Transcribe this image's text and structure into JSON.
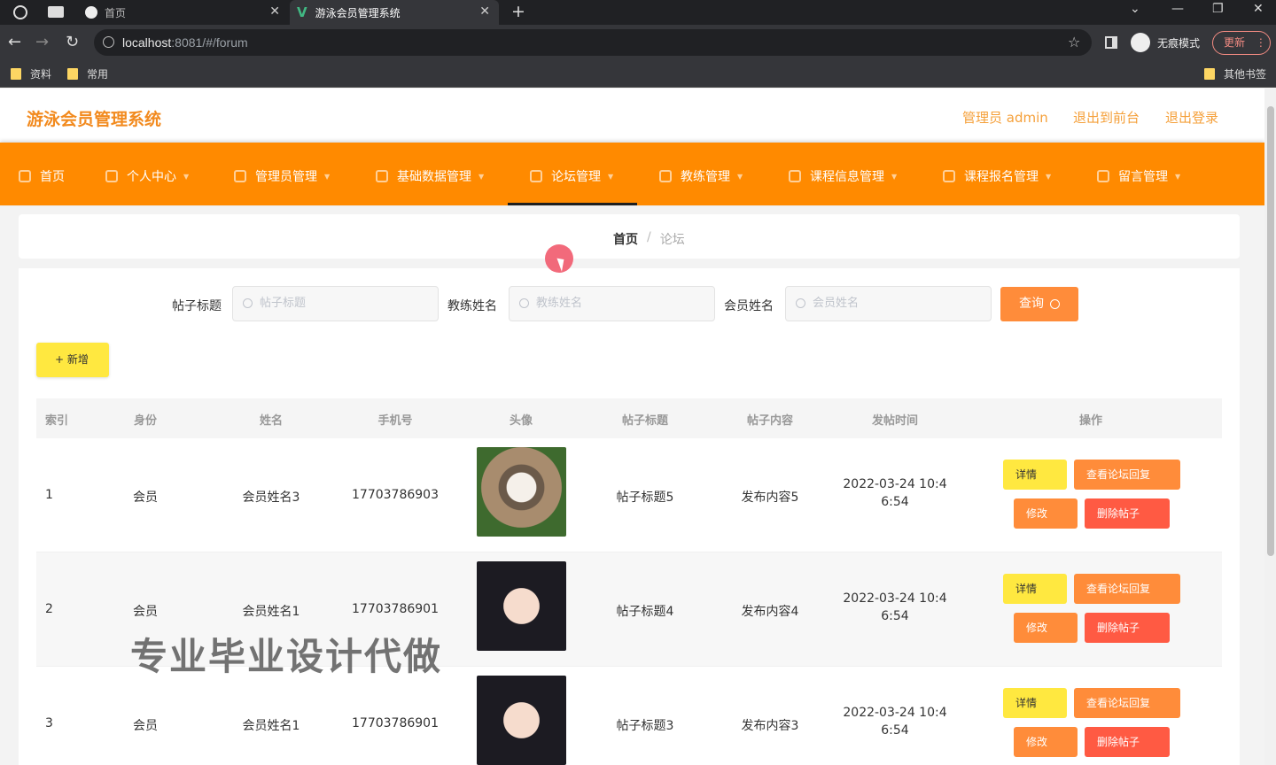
{
  "browser": {
    "tabs": [
      {
        "title": "首页"
      },
      {
        "title": "游泳会员管理系统"
      }
    ],
    "url_host": "localhost",
    "url_path": ":8081/#/forum",
    "incognito_label": "无痕模式",
    "update_label": "更新",
    "bookmarks": [
      "资料",
      "常用"
    ],
    "other_bookmarks": "其他书签"
  },
  "header": {
    "title": "游泳会员管理系统",
    "admin_label": "管理员 admin",
    "to_front_label": "退出到前台",
    "logout_label": "退出登录"
  },
  "menu": [
    {
      "label": "首页",
      "icon": "home-icon"
    },
    {
      "label": "个人中心",
      "icon": "user-icon"
    },
    {
      "label": "管理员管理",
      "icon": "admin-icon"
    },
    {
      "label": "基础数据管理",
      "icon": "list-icon"
    },
    {
      "label": "论坛管理",
      "icon": "forum-icon",
      "active": true
    },
    {
      "label": "教练管理",
      "icon": "coach-icon"
    },
    {
      "label": "课程信息管理",
      "icon": "course-icon"
    },
    {
      "label": "课程报名管理",
      "icon": "signup-icon"
    },
    {
      "label": "留言管理",
      "icon": "message-icon"
    }
  ],
  "breadcrumb": {
    "home": "首页",
    "separator": "/",
    "current": "论坛"
  },
  "filters": {
    "post_title_label": "帖子标题",
    "post_title_placeholder": "帖子标题",
    "coach_name_label": "教练姓名",
    "coach_name_placeholder": "教练姓名",
    "member_name_label": "会员姓名",
    "member_name_placeholder": "会员姓名",
    "search_label": "查询"
  },
  "add_label": "+ 新增",
  "table": {
    "columns": [
      "索引",
      "身份",
      "姓名",
      "手机号",
      "头像",
      "帖子标题",
      "帖子内容",
      "发帖时间",
      "操作"
    ],
    "rows": [
      {
        "index": "1",
        "role": "会员",
        "name": "会员姓名3",
        "phone": "17703786903",
        "avatar": "cat-photo",
        "title": "帖子标题5",
        "content": "发布内容5",
        "time1": "2022-03-24 10:4",
        "time2": "6:54"
      },
      {
        "index": "2",
        "role": "会员",
        "name": "会员姓名1",
        "phone": "17703786901",
        "avatar": "girl-photo",
        "title": "帖子标题4",
        "content": "发布内容4",
        "time1": "2022-03-24 10:4",
        "time2": "6:54"
      },
      {
        "index": "3",
        "role": "会员",
        "name": "会员姓名1",
        "phone": "17703786901",
        "avatar": "girl-photo",
        "title": "帖子标题3",
        "content": "发布内容3",
        "time1": "2022-03-24 10:4",
        "time2": "6:54"
      }
    ],
    "actions": {
      "detail": "详情",
      "reply": "查看论坛回复",
      "edit": "修改",
      "delete": "删除帖子"
    }
  },
  "watermark": "专业毕业设计代做",
  "colors": {
    "accent": "#ff8a00",
    "title": "#f28a1e",
    "detail": "#ffe840",
    "delete": "#ff5a43"
  }
}
